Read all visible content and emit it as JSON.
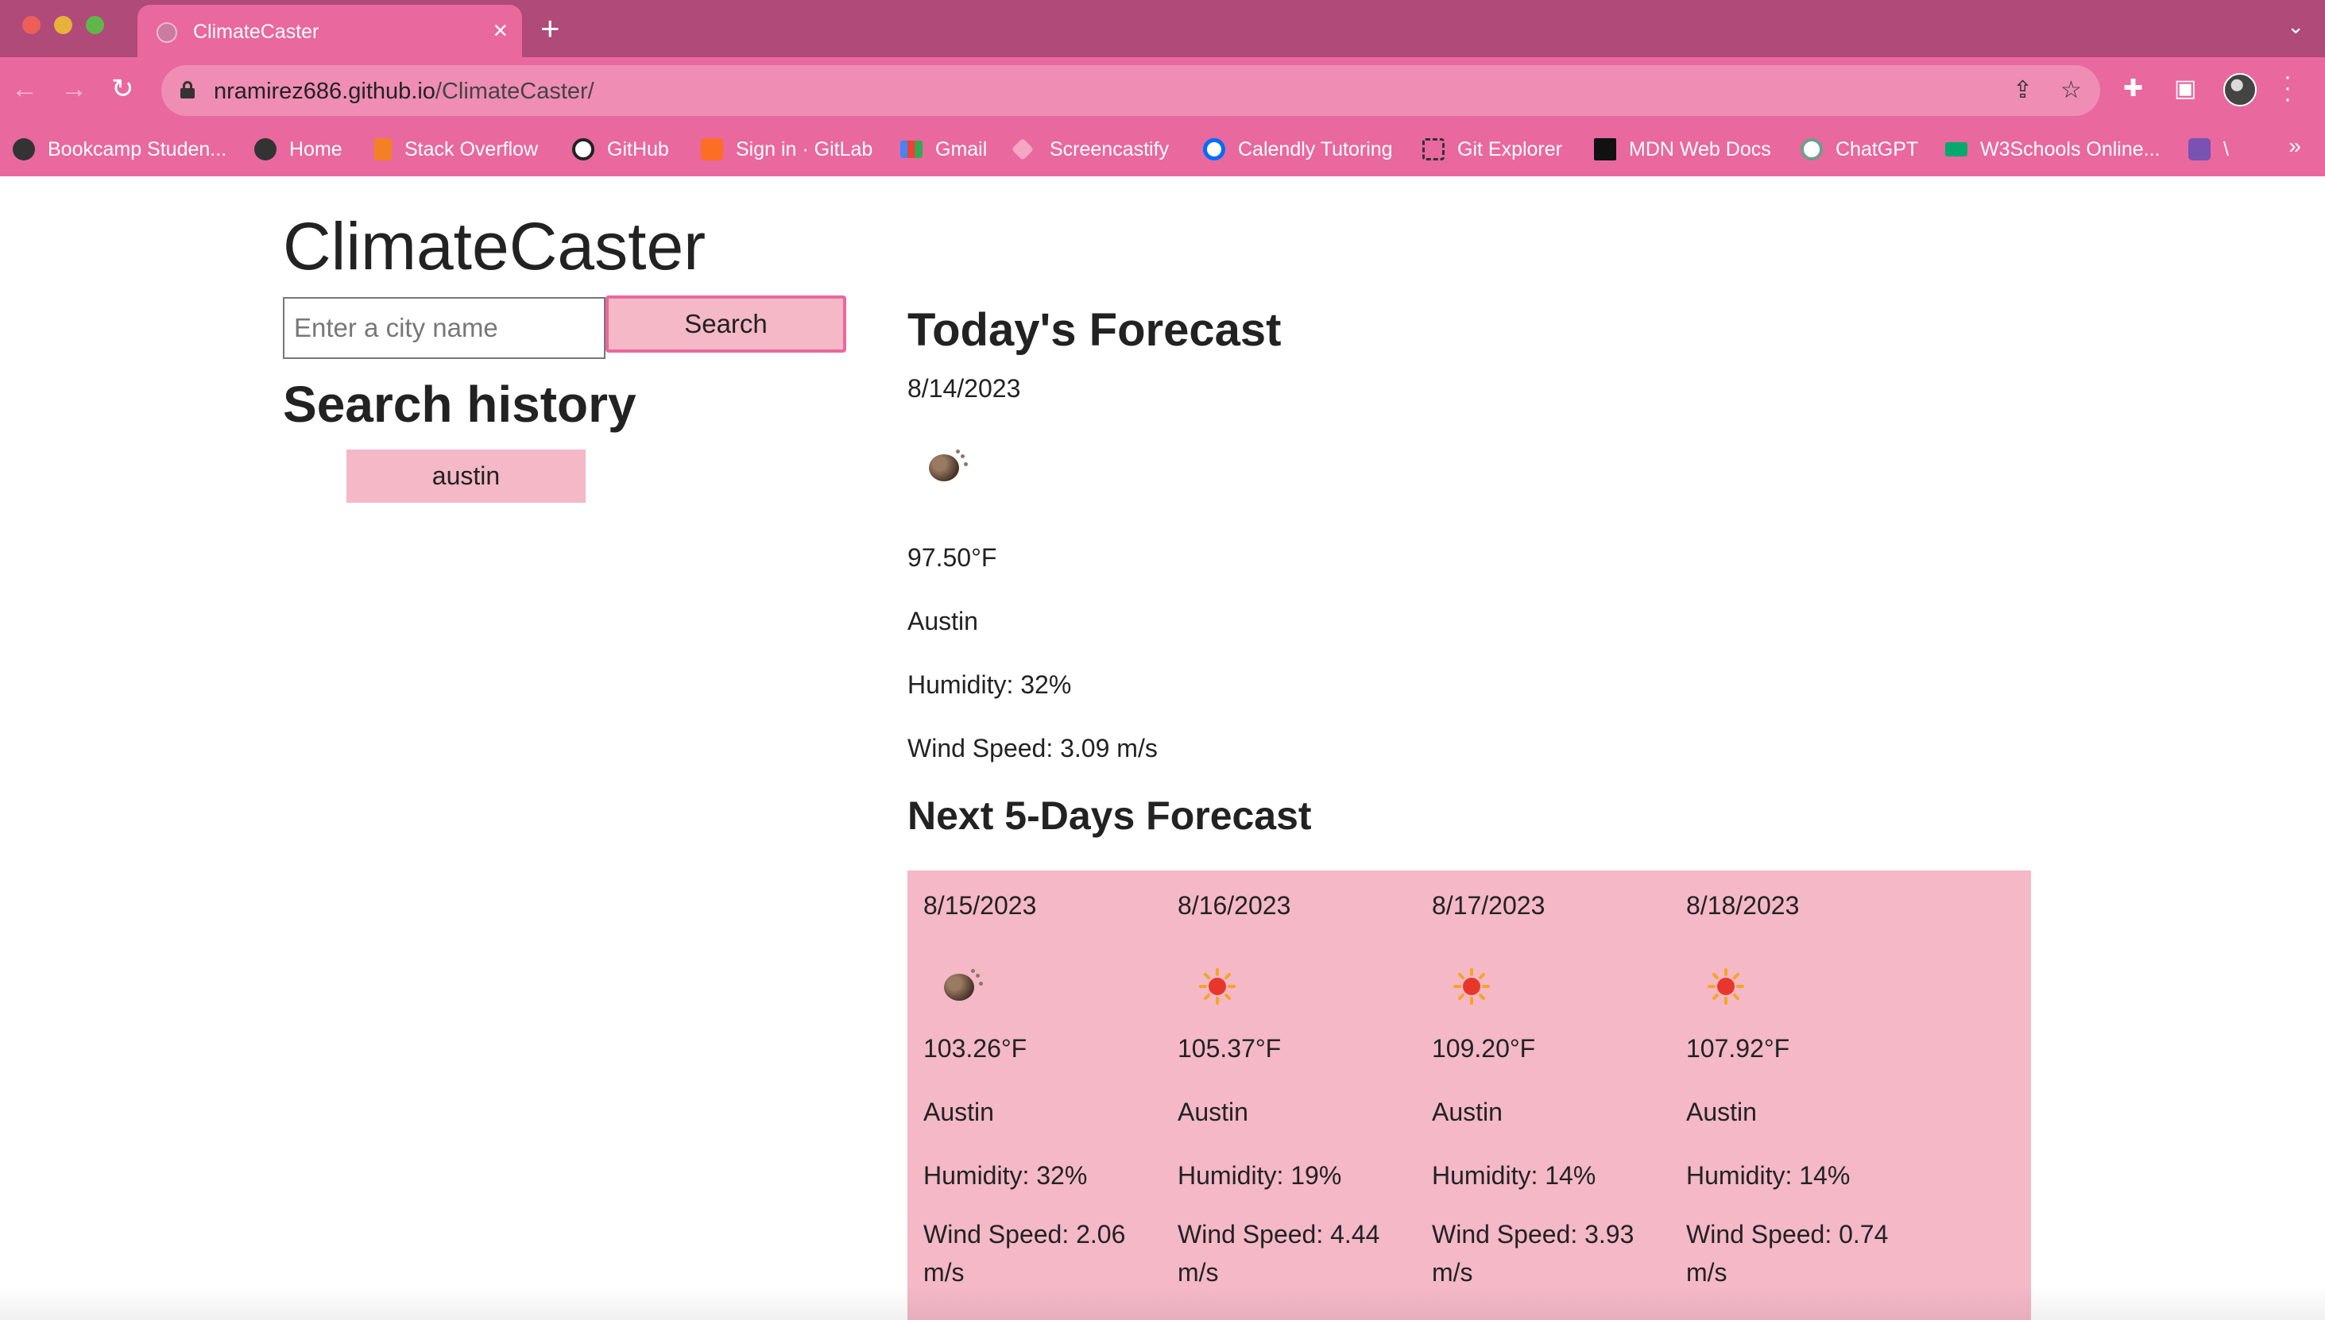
{
  "browser": {
    "tab_title": "ClimateCaster",
    "url_host": "nramirez686.github.io",
    "url_path": "/ClimateCaster/",
    "bookmarks": [
      {
        "label": "Bookcamp Studen...",
        "icon": "globe-icon"
      },
      {
        "label": "Home",
        "icon": "globe-icon"
      },
      {
        "label": "Stack Overflow",
        "icon": "stackoverflow-icon"
      },
      {
        "label": "GitHub",
        "icon": "github-icon"
      },
      {
        "label": "Sign in · GitLab",
        "icon": "gitlab-icon"
      },
      {
        "label": "Gmail",
        "icon": "gmail-icon"
      },
      {
        "label": "Screencastify",
        "icon": "screencastify-icon"
      },
      {
        "label": "Calendly Tutoring",
        "icon": "calendly-icon"
      },
      {
        "label": "Git Explorer",
        "icon": "git-explorer-icon"
      },
      {
        "label": "MDN Web Docs",
        "icon": "mdn-icon"
      },
      {
        "label": "ChatGPT",
        "icon": "chatgpt-icon"
      },
      {
        "label": "W3Schools Online...",
        "icon": "w3schools-icon"
      },
      {
        "label": "\\",
        "icon": "bootstrap-icon"
      }
    ],
    "colors": {
      "tabstrip": "#b04a78",
      "toolbar": "#e9689e",
      "omnibox": "#ef8db5"
    }
  },
  "app": {
    "title": "ClimateCaster",
    "search": {
      "placeholder": "Enter a city name",
      "button_label": "Search"
    },
    "history": {
      "title": "Search history",
      "items": [
        "austin"
      ]
    },
    "accent_color": "#f4b8c7"
  },
  "today": {
    "title": "Today's Forecast",
    "date": "8/14/2023",
    "icon": "night-clouds-icon",
    "temp": "97.50°F",
    "city": "Austin",
    "humidity": "Humidity: 32%",
    "wind": "Wind Speed: 3.09 m/s"
  },
  "five_day": {
    "title": "Next 5-Days Forecast",
    "days": [
      {
        "date": "8/15/2023",
        "icon": "night-clouds-icon",
        "temp": "103.26°F",
        "city": "Austin",
        "humidity": "Humidity: 32%",
        "wind": "Wind Speed: 2.06 m/s"
      },
      {
        "date": "8/16/2023",
        "icon": "sun-icon",
        "temp": "105.37°F",
        "city": "Austin",
        "humidity": "Humidity: 19%",
        "wind": "Wind Speed: 4.44 m/s"
      },
      {
        "date": "8/17/2023",
        "icon": "sun-icon",
        "temp": "109.20°F",
        "city": "Austin",
        "humidity": "Humidity: 14%",
        "wind": "Wind Speed: 3.93 m/s"
      },
      {
        "date": "8/18/2023",
        "icon": "sun-icon",
        "temp": "107.92°F",
        "city": "Austin",
        "humidity": "Humidity: 14%",
        "wind": "Wind Speed: 0.74 m/s"
      }
    ]
  }
}
